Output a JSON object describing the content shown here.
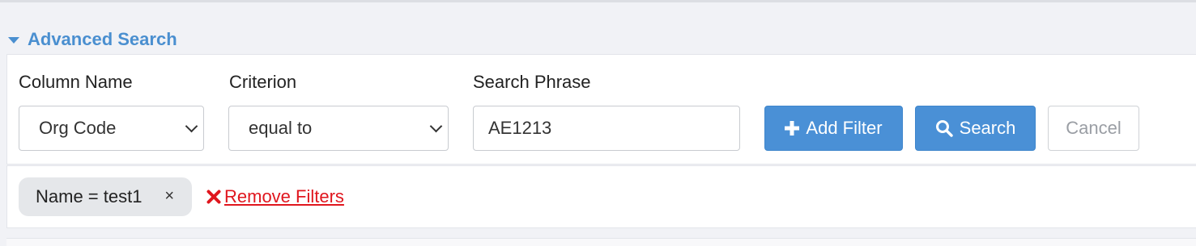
{
  "advanced_search": {
    "title": "Advanced Search"
  },
  "form": {
    "column_label": "Column Name",
    "column_value": "Org Code",
    "criterion_label": "Criterion",
    "criterion_value": "equal to",
    "phrase_label": "Search Phrase",
    "phrase_value": "AE1213"
  },
  "buttons": {
    "add_filter": "Add Filter",
    "search": "Search",
    "cancel": "Cancel"
  },
  "filters": {
    "chips": [
      {
        "label": "Name = test1",
        "remove": "×"
      }
    ],
    "remove_all": "Remove Filters"
  },
  "icons": {
    "toggle": "caret-down-icon",
    "add": "plus-icon",
    "search": "magnifier-icon",
    "remove_all": "close-icon"
  },
  "colors": {
    "accent": "#4a8fd0",
    "primary_button": "#4a90d6",
    "danger": "#e0161e",
    "chip_bg": "#e5e7ea"
  }
}
